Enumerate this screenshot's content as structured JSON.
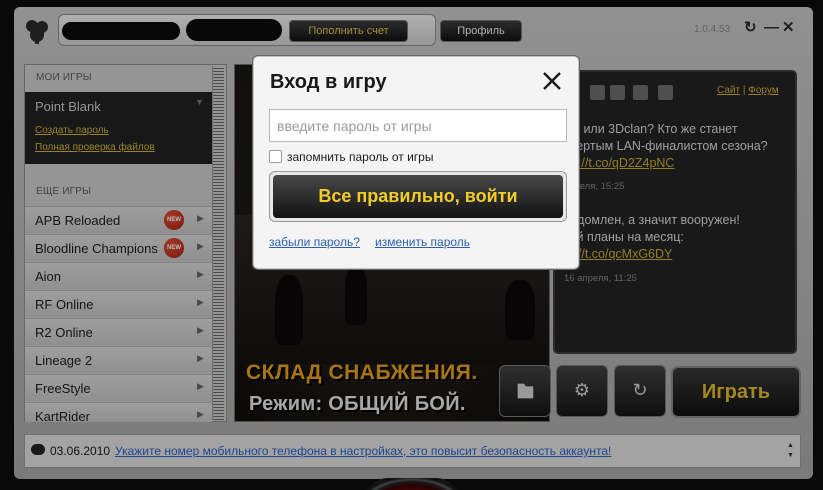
{
  "header": {
    "refill_label": "Пополнить счет",
    "profile_label": "Профиль",
    "version": "1.0.4.53",
    "refresh_glyph": "↻",
    "minimize_glyph": "—",
    "close_glyph": "✕"
  },
  "sidebar": {
    "my_games_title": "МОИ ИГРЫ",
    "current_game": "Point Blank",
    "links": [
      "Создать пароль",
      "Полная проверка файлов"
    ],
    "more_games_title": "ЕЩЕ ИГРЫ",
    "games": [
      {
        "name": "APB Reloaded",
        "badge": "NEW"
      },
      {
        "name": "Bloodline Champions",
        "badge": "NEW"
      },
      {
        "name": "Aion",
        "badge": ""
      },
      {
        "name": "RF Online",
        "badge": ""
      },
      {
        "name": "R2 Online",
        "badge": ""
      },
      {
        "name": "Lineage 2",
        "badge": ""
      },
      {
        "name": "FreeStyle",
        "badge": ""
      },
      {
        "name": "KartRider",
        "badge": ""
      }
    ]
  },
  "banner": {
    "line1": "СКЛАД СНАБЖЕНИЯ.",
    "line2": "Режим: ОБЩИЙ БОЙ."
  },
  "news": {
    "links": [
      "Сайт",
      "Форум"
    ],
    "item1_text": "nD или 3Dclan? Кто же станет\nтвертым LAN-финалистом сезона?",
    "item1_link": "ttp://t.co/qD2Z4pNC",
    "item1_date": "апреля, 15:25",
    "item2_text": "ведомлен, а значит вооружен!\nтай планы на месяц:",
    "item2_link": "tp://t.co/qcMxG6DY",
    "item2_date": "16 апреля, 11:25"
  },
  "actions": {
    "play_label": "Играть",
    "folder_icon": "folder-icon",
    "settings_icon": "gear-icon",
    "refresh_icon": "refresh-icon"
  },
  "status": {
    "date": "03.06.2010",
    "message": "Укажите номер мобильного телефона в настройках, это повысит безопасность аккаунта!"
  },
  "login_dialog": {
    "title": "Вход в игру",
    "password_placeholder": "введите пароль от игры",
    "remember_label": "запомнить пароль от игры",
    "submit_label": "Все правильно, войти",
    "forgot_link": "забыли пароль?",
    "change_link": "изменить пароль"
  },
  "colors": {
    "accent_gold": "#e4bd2c",
    "badge_red": "#c8311f",
    "link_blue": "#2d62c8"
  }
}
